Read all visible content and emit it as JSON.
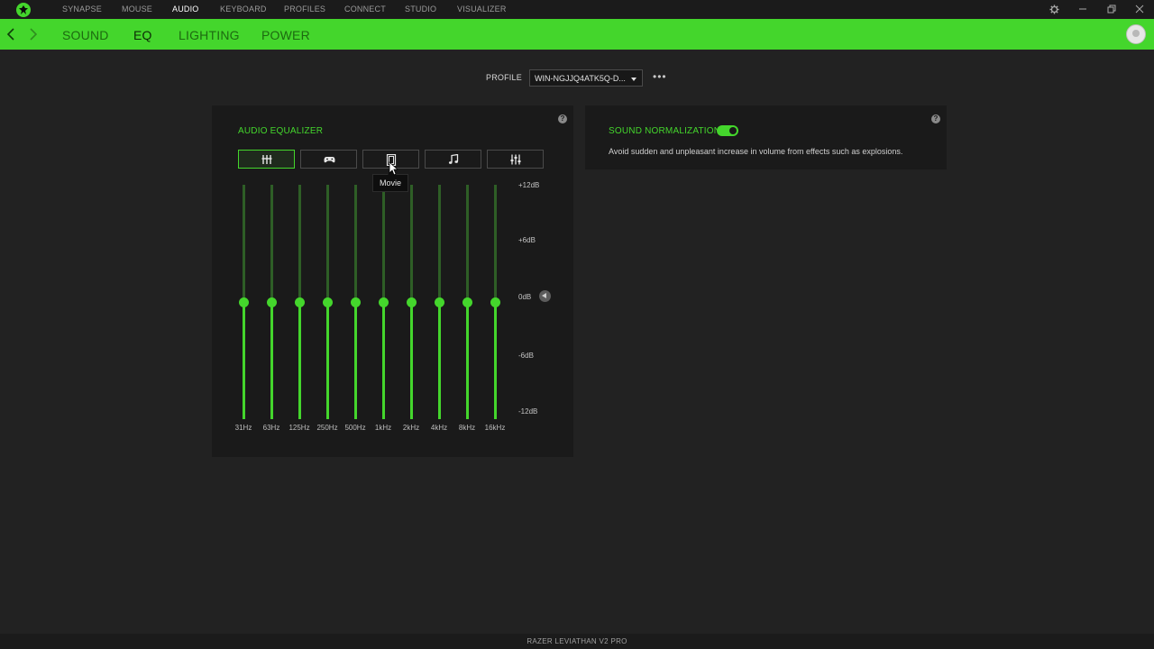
{
  "topnav": {
    "items": [
      {
        "label": "SYNAPSE"
      },
      {
        "label": "MOUSE"
      },
      {
        "label": "AUDIO",
        "active": true
      },
      {
        "label": "KEYBOARD"
      },
      {
        "label": "PROFILES"
      },
      {
        "label": "CONNECT"
      },
      {
        "label": "STUDIO"
      },
      {
        "label": "VISUALIZER"
      }
    ],
    "window_controls": [
      "gear-icon",
      "minimize-icon",
      "restore-icon",
      "close-icon"
    ]
  },
  "subnav": {
    "tabs": [
      {
        "label": "SOUND"
      },
      {
        "label": "EQ",
        "active": true
      },
      {
        "label": "LIGHTING"
      },
      {
        "label": "POWER"
      }
    ]
  },
  "profile": {
    "label": "PROFILE",
    "selected": "WIN-NGJJQ4ATK5Q-D...",
    "more": "•••"
  },
  "equalizer": {
    "title": "AUDIO EQUALIZER",
    "presets": [
      {
        "icon": "default-eq-icon",
        "active": true
      },
      {
        "icon": "gamepad-icon"
      },
      {
        "icon": "movie-icon",
        "hover": true
      },
      {
        "icon": "music-note-icon"
      },
      {
        "icon": "custom-eq-icon"
      }
    ],
    "tooltip": "Movie",
    "db_labels": [
      "+12dB",
      "+6dB",
      "0dB",
      "-6dB",
      "-12dB"
    ],
    "range_db": [
      -12,
      12
    ],
    "bands": [
      {
        "freq": "31Hz",
        "gain_db": 0
      },
      {
        "freq": "63Hz",
        "gain_db": 0
      },
      {
        "freq": "125Hz",
        "gain_db": 0
      },
      {
        "freq": "250Hz",
        "gain_db": 0
      },
      {
        "freq": "500Hz",
        "gain_db": 0
      },
      {
        "freq": "1kHz",
        "gain_db": 0
      },
      {
        "freq": "2kHz",
        "gain_db": 0
      },
      {
        "freq": "4kHz",
        "gain_db": 0
      },
      {
        "freq": "8kHz",
        "gain_db": 0
      },
      {
        "freq": "16kHz",
        "gain_db": 0
      }
    ]
  },
  "normalization": {
    "title": "SOUND NORMALIZATION",
    "enabled": true,
    "description": "Avoid sudden and unpleasant increase in volume from effects such as explosions."
  },
  "footer": {
    "device": "RAZER LEVIATHAN V2 PRO"
  },
  "colors": {
    "accent": "#44d62c",
    "background": "#222222",
    "panel": "#1a1a1a"
  }
}
